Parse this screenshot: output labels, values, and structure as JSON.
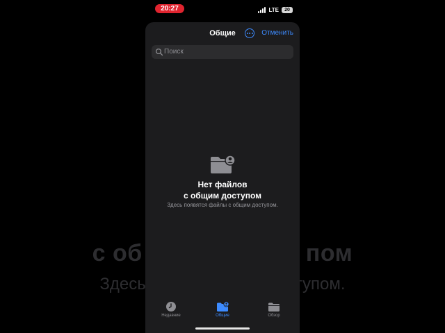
{
  "status": {
    "time": "20:27",
    "network": "LTE",
    "battery": "20"
  },
  "nav": {
    "title": "Общие",
    "cancel": "Отменить"
  },
  "search": {
    "placeholder": "Поиск"
  },
  "empty_state": {
    "title_line1": "Нет файлов",
    "title_line2": "с общим доступом",
    "subtitle": "Здесь появятся файлы с общим доступом."
  },
  "background_echo": {
    "line1_left": "с об",
    "line1_right": "пом",
    "line2_left": "Здесь появя",
    "line2_right": "м доступом."
  },
  "tabs": [
    {
      "label": "Недавние",
      "icon": "clock-icon",
      "active": false
    },
    {
      "label": "Общие",
      "icon": "shared-folder-icon",
      "active": true
    },
    {
      "label": "Обзор",
      "icon": "folder-icon",
      "active": false
    }
  ],
  "colors": {
    "accent": "#3d8bff",
    "time_pill": "#e0242f",
    "sheet": "#1c1c1e",
    "search_field": "#2c2c2e"
  }
}
